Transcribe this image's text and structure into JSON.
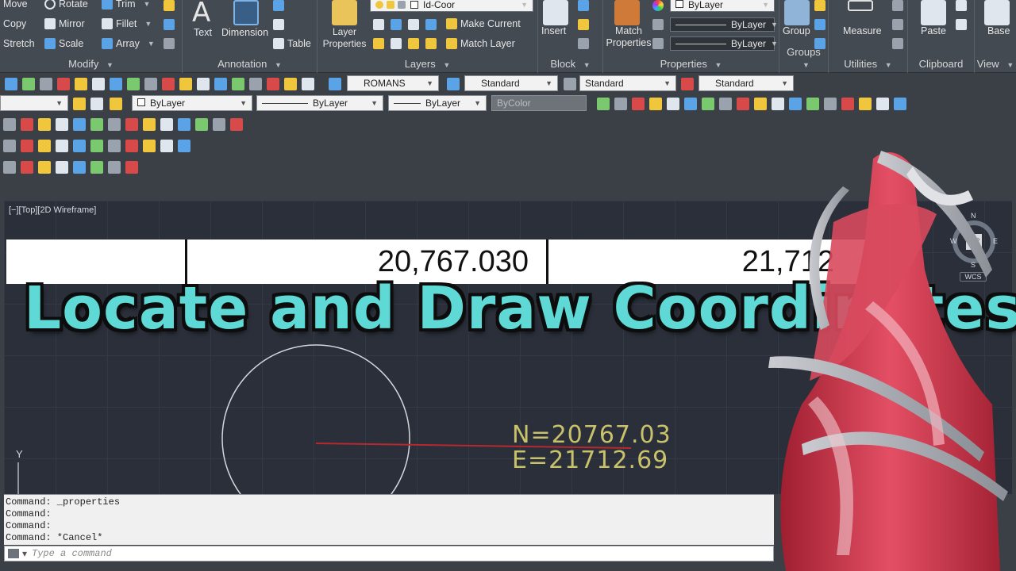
{
  "ribbon": {
    "modify": {
      "title": "Modify",
      "items": [
        "Move",
        "Rotate",
        "Trim",
        "Copy",
        "Mirror",
        "Fillet",
        "Stretch",
        "Scale",
        "Array"
      ]
    },
    "annotation": {
      "title": "Annotation",
      "text": "Text",
      "dimension": "Dimension",
      "table": "Table"
    },
    "layers": {
      "title": "Layers",
      "layer_properties": "Layer Properties",
      "current_layer": "Id-Coor",
      "make_current": "Make Current",
      "match_layer": "Match Layer"
    },
    "block": {
      "title": "Block",
      "insert": "Insert"
    },
    "properties": {
      "title": "Properties",
      "match_properties": "Match Properties",
      "color": "ByLayer",
      "linetype": "ByLayer",
      "lineweight": "ByLayer"
    },
    "groups": {
      "title": "Groups",
      "group": "Group"
    },
    "utilities": {
      "title": "Utilities",
      "measure": "Measure"
    },
    "clipboard": {
      "title": "Clipboard",
      "paste": "Paste"
    },
    "view": {
      "title": "View",
      "base": "Base"
    }
  },
  "toolbar": {
    "text_style": "ROMANS",
    "dim_style": "Standard",
    "table_style": "Standard",
    "multileader_style": "Standard",
    "color": "ByLayer",
    "linetype": "ByLayer",
    "lineweight": "ByLayer",
    "plotstyle": "ByColor"
  },
  "viewport": {
    "label": "[−][Top][2D Wireframe]",
    "table_value_1": "20,767.030",
    "table_value_2": "21,712",
    "northing": "N=20767.03",
    "easting": "E=21712.69",
    "y_axis": "Y",
    "viewcube": {
      "n": "N",
      "s": "S",
      "e": "E",
      "w": "W",
      "top": "TOP",
      "wcs": "WCS"
    }
  },
  "overlay_title": "Locate and Draw Coordinates",
  "command_history": [
    "Command: _properties",
    "Command:",
    "Command:",
    "Command: *Cancel*"
  ],
  "command_input": {
    "placeholder": "Type a command"
  },
  "colors": {
    "title_fill": "#5fd9d6",
    "title_outline": "#0d0d0d",
    "coord_text": "#c9c26a",
    "red_line": "#b8282f",
    "tower_red": "#d3394c"
  }
}
